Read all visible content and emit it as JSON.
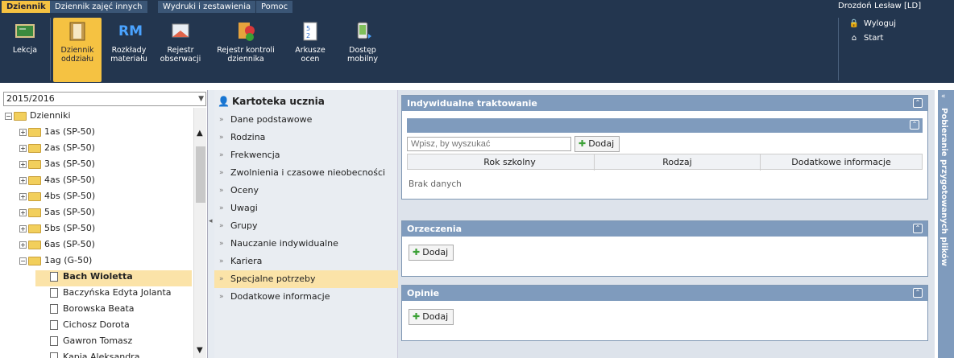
{
  "menu": {
    "tabs": [
      "Dziennik",
      "Dziennik zajęć innych",
      "Wydruki i zestawienia",
      "Pomoc"
    ]
  },
  "user": {
    "name": "Drozdoń Lesław [LD]",
    "logout": "Wyloguj",
    "start": "Start"
  },
  "toolbar": [
    {
      "label": "Lekcja",
      "icon": "lesson-board-icon"
    },
    {
      "label": "Dziennik\noddziału",
      "icon": "binder-icon"
    },
    {
      "label": "Rozkłady\nmateriału",
      "icon": "rm-icon"
    },
    {
      "label": "Rejestr\nobserwacji",
      "icon": "observation-register-icon"
    },
    {
      "label": "Rejestr kontroli\ndziennika",
      "icon": "control-register-icon"
    },
    {
      "label": "Arkusze\nocen",
      "icon": "grade-sheet-icon"
    },
    {
      "label": "Dostęp\nmobilny",
      "icon": "mobile-access-icon"
    }
  ],
  "rm_text": "RM",
  "year": "2015/2016",
  "tree": {
    "root": "Dzienniki",
    "classes": [
      "1as (SP-50)",
      "2as (SP-50)",
      "3as (SP-50)",
      "4as (SP-50)",
      "4bs (SP-50)",
      "5as (SP-50)",
      "5bs (SP-50)",
      "6as (SP-50)",
      "1ag (G-50)"
    ],
    "students": [
      "Bach Wioletta",
      "Baczyńska Edyta Jolanta",
      "Borowska Beata",
      "Cichosz Dorota",
      "Gawron Tomasz",
      "Kapia Aleksandra"
    ]
  },
  "card": {
    "title": "Kartoteka ucznia",
    "items": [
      "Dane podstawowe",
      "Rodzina",
      "Frekwencja",
      "Zwolnienia i czasowe nieobecności",
      "Oceny",
      "Uwagi",
      "Grupy",
      "Nauczanie indywidualne",
      "Kariera",
      "Specjalne potrzeby",
      "Dodatkowe informacje"
    ]
  },
  "panel1": {
    "title": "Indywidualne traktowanie",
    "search_placeholder": "Wpisz, by wyszukać",
    "add": "Dodaj",
    "columns": [
      "Rok szkolny",
      "Rodzaj",
      "Dodatkowe informacje"
    ],
    "empty": "Brak danych"
  },
  "panel2": {
    "title": "Orzeczenia",
    "add": "Dodaj"
  },
  "panel3": {
    "title": "Opinie",
    "add": "Dodaj"
  },
  "side": {
    "title": "Pobieranie przygotowanych plików"
  },
  "colors": {
    "topbar": "#23364f",
    "accent": "#f5c242",
    "panel_header": "#7f9bbd",
    "selected": "#fbe3a8"
  }
}
